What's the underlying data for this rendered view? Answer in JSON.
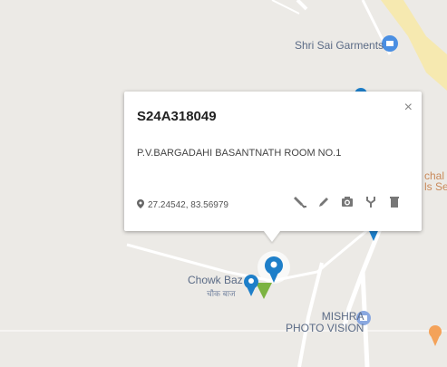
{
  "map": {
    "pois": [
      {
        "name": "Shri Sai Garments"
      },
      {
        "name": "Chowk Baz",
        "subtext": "चौक बाज"
      },
      {
        "name": "MISHRA\nPHOTO VISION"
      },
      {
        "name": "chal",
        "line2": "ls Se"
      }
    ]
  },
  "popup": {
    "title": "S24A318049",
    "address": "P.V.BARGADAHI BASANTNATH ROOM NO.1",
    "coords": "27.24542, 83.56979",
    "close_symbol": "×",
    "actions": [
      "edit-marker-icon",
      "pencil-icon",
      "camera-icon",
      "fork-icon",
      "trash-icon"
    ]
  },
  "colors": {
    "marker_blue": "#1e7fc9",
    "marker_green": "#7cb342",
    "road_yellow": "#f6e9b0",
    "land": "#eceae6",
    "poi_orange": "#f4a259"
  }
}
